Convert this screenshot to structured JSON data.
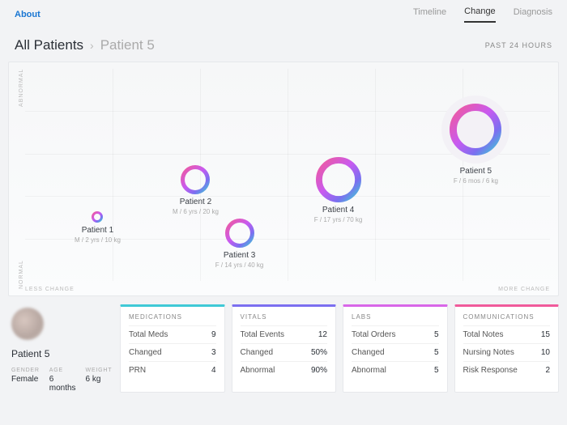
{
  "topbar": {
    "about": "About",
    "tabs": [
      "Timeline",
      "Change",
      "Diagnosis"
    ],
    "active_tab": 1
  },
  "breadcrumb": {
    "all": "All Patients",
    "chevron": "›",
    "current": "Patient 5",
    "timeframe": "PAST 24 HOURS"
  },
  "axes": {
    "y_top": "ABNORMAL",
    "y_bottom": "NORMAL",
    "x_left": "LESS CHANGE",
    "x_right": "MORE CHANGE"
  },
  "chart_data": {
    "type": "scatter",
    "title": "",
    "xlabel": "Change",
    "ylabel": "Abnormality",
    "x_range_labels": [
      "LESS CHANGE",
      "MORE CHANGE"
    ],
    "y_range_labels": [
      "NORMAL",
      "ABNORMAL"
    ],
    "series": [
      {
        "name": "Patient 1",
        "meta": "M / 2 yrs / 10 kg",
        "x": 0.1,
        "y": 0.3,
        "size": 14,
        "selected": false
      },
      {
        "name": "Patient 2",
        "meta": "M / 6 yrs / 20 kg",
        "x": 0.3,
        "y": 0.48,
        "size": 36,
        "selected": false
      },
      {
        "name": "Patient 3",
        "meta": "F / 14 yrs / 40 kg",
        "x": 0.38,
        "y": 0.22,
        "size": 36,
        "selected": false
      },
      {
        "name": "Patient 4",
        "meta": "F / 17 yrs / 70 kg",
        "x": 0.58,
        "y": 0.48,
        "size": 56,
        "selected": false
      },
      {
        "name": "Patient 5",
        "meta": "F / 6 mos / 6 kg",
        "x": 0.84,
        "y": 0.72,
        "size": 64,
        "selected": true
      }
    ]
  },
  "detail": {
    "name": "Patient 5",
    "stats": [
      {
        "label": "GENDER",
        "value": "Female"
      },
      {
        "label": "AGE",
        "value": "6 months"
      },
      {
        "label": "WEIGHT",
        "value": "6 kg"
      }
    ]
  },
  "cards": [
    {
      "title": "MEDICATIONS",
      "color": "c-teal",
      "rows": [
        [
          "Total Meds",
          "9"
        ],
        [
          "Changed",
          "3"
        ],
        [
          "PRN",
          "4"
        ]
      ]
    },
    {
      "title": "VITALS",
      "color": "c-purple",
      "rows": [
        [
          "Total Events",
          "12"
        ],
        [
          "Changed",
          "50%"
        ],
        [
          "Abnormal",
          "90%"
        ]
      ]
    },
    {
      "title": "LABS",
      "color": "c-pink",
      "rows": [
        [
          "Total Orders",
          "5"
        ],
        [
          "Changed",
          "5"
        ],
        [
          "Abnormal",
          "5"
        ]
      ]
    },
    {
      "title": "COMMUNICATIONS",
      "color": "c-rose",
      "rows": [
        [
          "Total Notes",
          "15"
        ],
        [
          "Nursing Notes",
          "10"
        ],
        [
          "Risk Response",
          "2"
        ]
      ]
    }
  ]
}
